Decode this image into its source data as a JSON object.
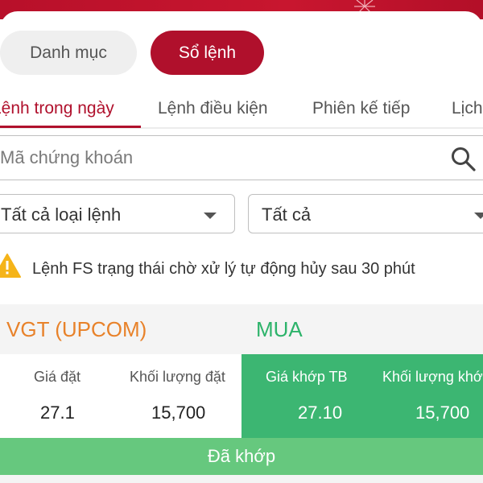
{
  "header": {
    "segments": [
      {
        "label": "Danh mục",
        "active": false
      },
      {
        "label": "Sổ lệnh",
        "active": true
      }
    ]
  },
  "tabs": [
    {
      "label": "Lệnh trong ngày",
      "active": true
    },
    {
      "label": "Lệnh điều kiện",
      "active": false
    },
    {
      "label": "Phiên kế tiếp",
      "active": false
    },
    {
      "label": "Lịch sử",
      "active": false
    }
  ],
  "search": {
    "placeholder": "Mã chứng khoán",
    "value": ""
  },
  "filters": {
    "order_type": "Tất cả loại lệnh",
    "status": "Tất cả"
  },
  "notice": {
    "text": "Lệnh FS trạng thái chờ xử lý tự động hủy sau 30 phút"
  },
  "order": {
    "symbol": "VGT (UPCOM)",
    "side": "MUA",
    "price_label": "Giá đặt",
    "price_value": "27.1",
    "qty_label": "Khối lượng đặt",
    "qty_value": "15,700",
    "avg_price_label": "Giá khớp TB",
    "avg_price_value": "27.10",
    "matched_qty_label": "Khối lượng khớp",
    "matched_qty_value": "15,700",
    "status": "Đã khớp"
  },
  "colors": {
    "brand": "#b0102c",
    "symbol": "#e8822a",
    "buy": "#2db36a",
    "matched": "#66c87e"
  },
  "icons": [
    "search-icon",
    "warning-icon",
    "chevron-down-icon"
  ]
}
